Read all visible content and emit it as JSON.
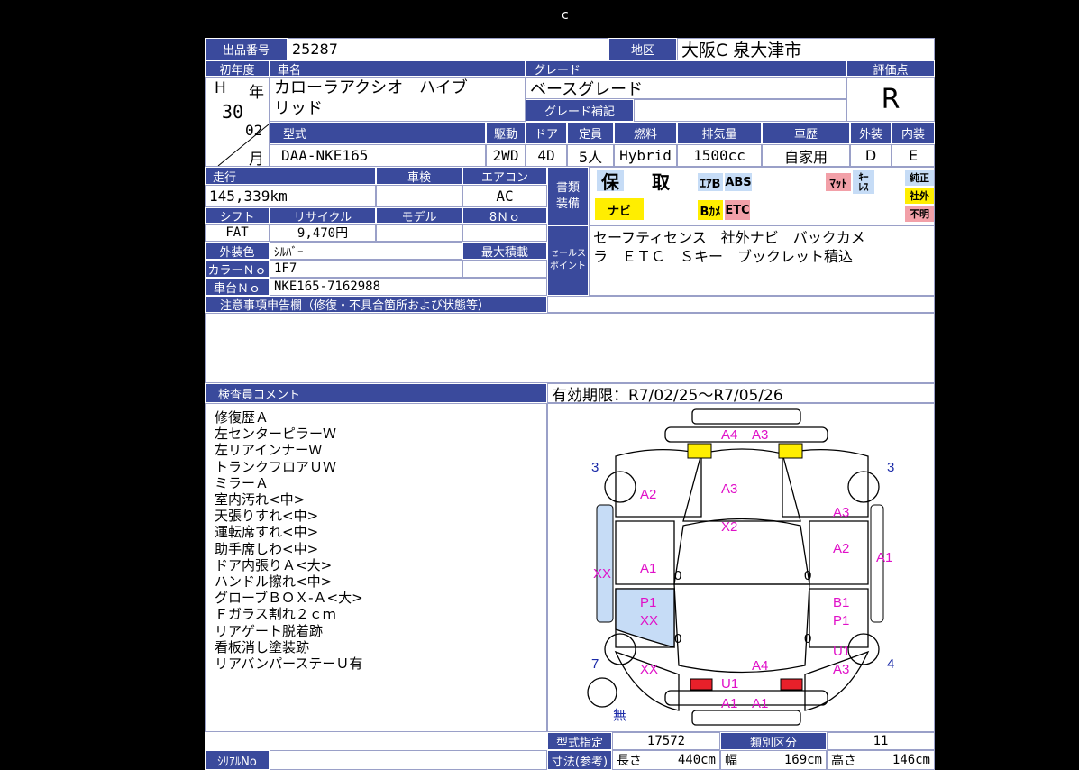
{
  "loading_glyph": "c",
  "header": {
    "lot_label": "出品番号",
    "lot_value": "25287",
    "region_label": "地区",
    "region_value": "大阪C 泉大津市",
    "first_reg_label": "初年度",
    "name_label": "車名",
    "grade_label": "グレード",
    "score_label": "評価点",
    "era": "H",
    "year_char": "年",
    "year_value": "30",
    "month_value": "02",
    "month_char": "月",
    "car_name_line1": "カローラアクシオ　ハイブ",
    "car_name_line2": "リッド",
    "grade_value": "ベースグレード",
    "grade_extra_label": "グレード補記",
    "score_value": "R"
  },
  "spec": {
    "model_label": "型式",
    "model_value": "DAA-NKE165",
    "drive_label": "駆動",
    "drive_value": "2WD",
    "door_label": "ドア",
    "door_value": "4D",
    "capacity_label": "定員",
    "capacity_value": "5人",
    "fuel_label": "燃料",
    "fuel_value": "Hybrid",
    "displacement_label": "排気量",
    "displacement_value": "1500cc",
    "history_label": "車歴",
    "history_value": "自家用",
    "exterior_label": "外装",
    "exterior_value": "D",
    "interior_label": "内装",
    "interior_value": "E"
  },
  "details": {
    "mileage_label": "走行",
    "mileage_value": "145,339km",
    "inspection_label": "車検",
    "inspection_value": "",
    "aircon_label": "エアコン",
    "aircon_value": "AC",
    "shift_label": "シフト",
    "shift_value": "FAT",
    "recycle_label": "リサイクル",
    "recycle_value": "9,470円",
    "model_year_label": "モデル",
    "eight_no_label": "8Ｎｏ",
    "color_label": "外装色",
    "color_value": "ｼﾙﾊﾞｰ",
    "max_load_label": "最大積載",
    "color_no_label": "カラーＮｏ",
    "color_no_value": "1F7",
    "chassis_label": "車台Ｎｏ",
    "chassis_value": "NKE165-7162988",
    "notice_label": "注意事項申告欄（修復・不具合箇所および状態等）"
  },
  "equipment": {
    "label_line1": "書類",
    "label_line2": "装備",
    "hosho": "保",
    "tori": "取",
    "airbag": "ｴｱB",
    "abs": "ABS",
    "mat": "ﾏｯﾄ",
    "keyless_1": "ｷｰ",
    "keyless_2": "ﾚｽ",
    "navi": "ナビ",
    "bcam": "Bｶﾒ",
    "etc": "ETC",
    "genuine": "純正",
    "aftermarket": "社外",
    "unknown": "不明",
    "colors": {
      "yellow": "#ffee00",
      "blue": "#c6dcf6",
      "pink": "#f2a0a8"
    }
  },
  "sales": {
    "label_line1": "セールス",
    "label_line2": "ポイント",
    "line1": "セーフティセンス　社外ナビ　バックカメ",
    "line2": "ラ　ＥＴＣ　Ｓキー　ブックレット積込"
  },
  "comments": {
    "label": "検査員コメント",
    "validity": "有効期限：R7/02/25～R7/05/26",
    "lines": [
      "修復歴Ａ",
      "左センターピラーＷ",
      "左リアインナーＷ",
      "トランクフロアＵＷ",
      "ミラーＡ",
      "室内汚れ<中>",
      "天張りすれ<中>",
      "運転席すれ<中>",
      "助手席しわ<中>",
      "ドア内張りＡ<大>",
      "ハンドル擦れ<中>",
      "グローブＢＯＸ-Ａ<大>",
      "Ｆガラス割れ２ｃｍ",
      "リアゲート脱着跡",
      "看板消し塗装跡",
      "リアバンパーステーＵ有"
    ]
  },
  "diagram": {
    "marks": {
      "front_bumper": "A4",
      "front_bumper_2": "A3",
      "hood": "A3",
      "left_fender": "A2",
      "roof": "X2",
      "left_front_door": "A1",
      "left_rear_door_1": "P1",
      "left_rear_door_2": "XX",
      "left_quarter": "XX",
      "left_sill": "XX",
      "trunk": "A4",
      "rear_panel": "U1",
      "rear_bumper_1": "A1",
      "rear_bumper_2": "A1",
      "right_fender": "A3",
      "right_front_door": "A2",
      "right_sill": "A1",
      "right_rear_door_1": "B1",
      "right_rear_door_2": "P1",
      "right_quarter_1": "U1",
      "right_quarter_2": "A3",
      "small_1": "0",
      "small_2": "0",
      "small_3": "0",
      "small_4": "0"
    },
    "tire_left_front": "3",
    "tire_right_front": "3",
    "tire_left_rear": "7",
    "tire_right_rear": "4",
    "spare": "無"
  },
  "footer": {
    "serial_label": "ｼﾘｱﾙNo",
    "type_cert_label": "型式指定",
    "type_cert_value": "17572",
    "class_label": "類別区分",
    "class_value": "11",
    "dims_label": "寸法(参考)",
    "length_label": "長さ",
    "length_value": "440cm",
    "width_label": "幅",
    "width_value": "169cm",
    "height_label": "高さ",
    "height_value": "146cm"
  }
}
